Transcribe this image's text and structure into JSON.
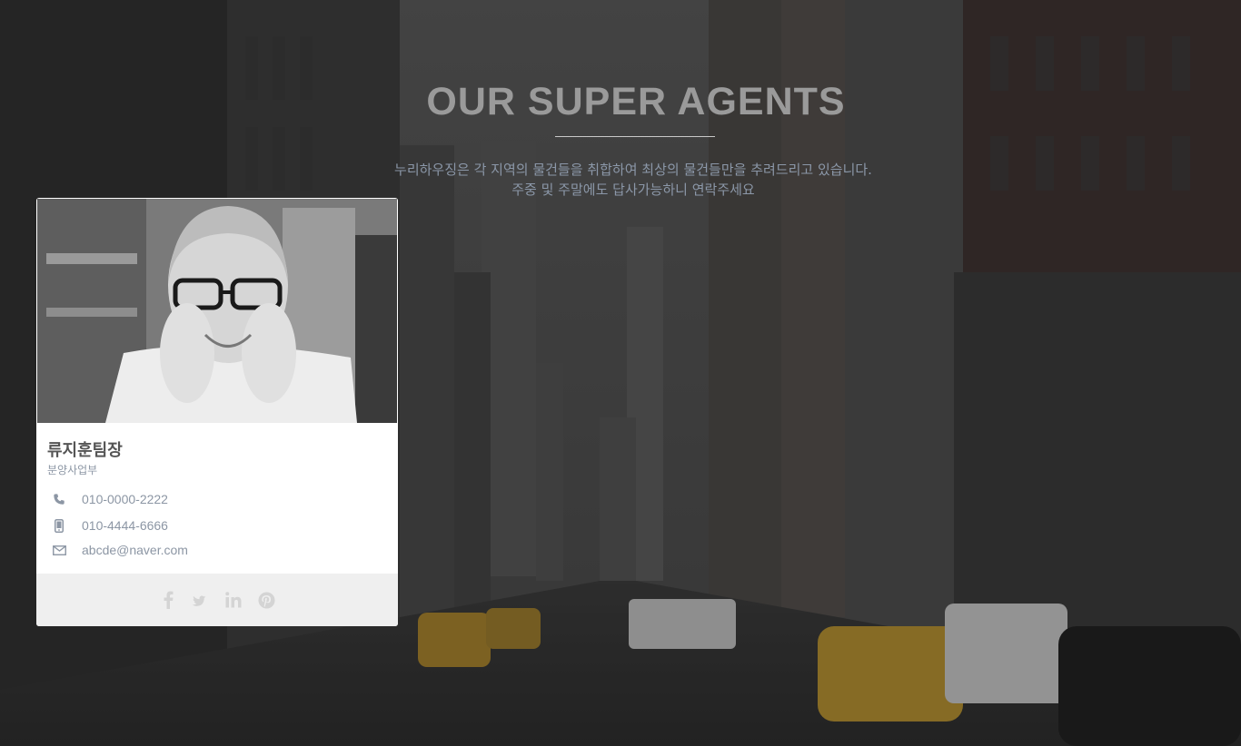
{
  "hero": {
    "title": "OUR SUPER AGENTS",
    "subtitle_line1": "누리하우징은 각 지역의 물건들을 취합하여 최상의 물건들만을 추려드리고 있습니다.",
    "subtitle_line2": "주중 및 주말에도 답사가능하니 연락주세요"
  },
  "agent": {
    "name": "류지훈팀장",
    "department": "분양사업부",
    "phone_icon": "phone-icon",
    "phone": "010-0000-2222",
    "mobile_icon": "mobile-icon",
    "mobile": "010-4444-6666",
    "email_icon": "envelope-icon",
    "email": "abcde@naver.com",
    "social": [
      "facebook-icon",
      "twitter-icon",
      "linkedin-icon",
      "pinterest-icon"
    ]
  },
  "colors": {
    "title": "#9a9a9a",
    "subtitle": "#8b97a8",
    "card_bg": "#ffffff",
    "social_bar_bg": "#efefef",
    "muted_text": "#8c96a4"
  }
}
